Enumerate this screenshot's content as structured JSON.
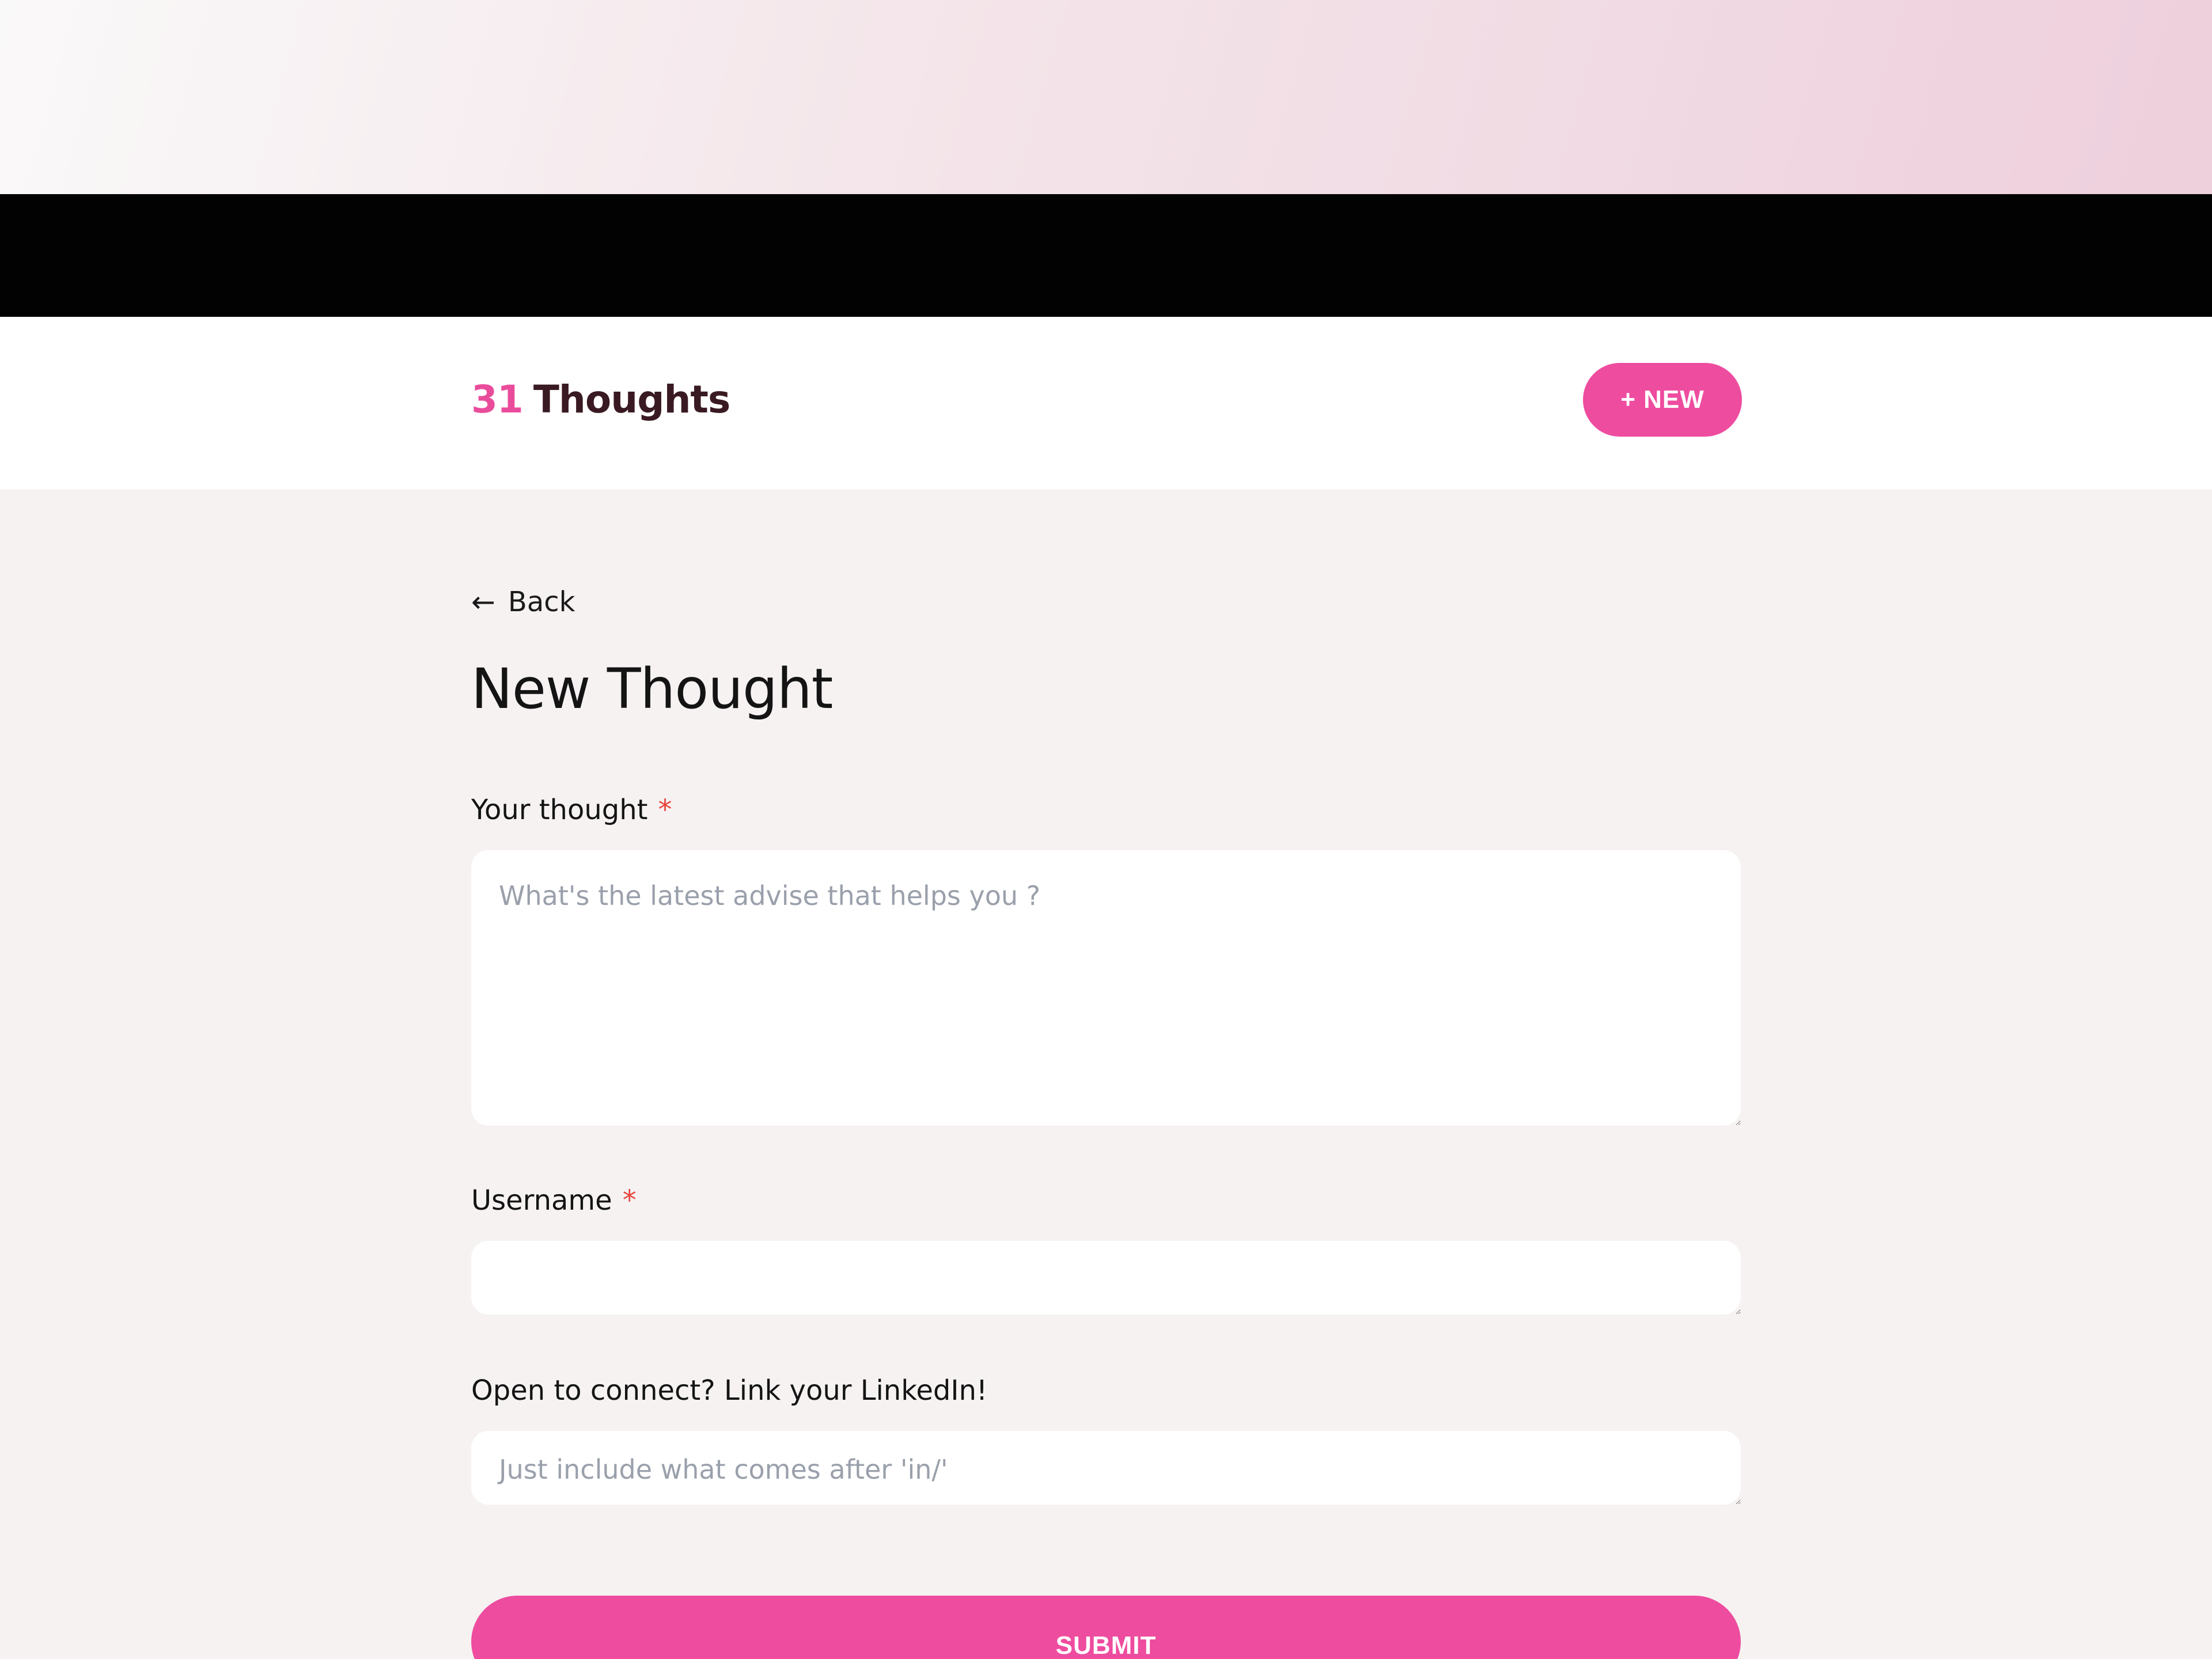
{
  "header": {
    "logo_number": "31",
    "logo_word": "Thoughts",
    "new_button_label": "+ NEW"
  },
  "nav": {
    "back_arrow": "←",
    "back_label": "Back"
  },
  "page": {
    "title": "New Thought"
  },
  "form": {
    "thought": {
      "label": "Your thought",
      "required_marker": "*",
      "value": "",
      "placeholder": "What's the latest advise that helps you ?"
    },
    "username": {
      "label": "Username",
      "required_marker": "*",
      "value": "",
      "placeholder": ""
    },
    "linkedin": {
      "label": "Open to connect? Link your LinkedIn!",
      "value": "",
      "placeholder": "Just include what comes after 'in/'"
    },
    "submit_label": "SUBMIT"
  },
  "colors": {
    "brand_pink": "#ee4c9f",
    "logo_text": "#3a1a22",
    "required_red": "#e8453c",
    "page_background": "#f6f2f2"
  },
  "icons": {
    "camera": "camera-icon",
    "back": "arrow-left-icon"
  }
}
